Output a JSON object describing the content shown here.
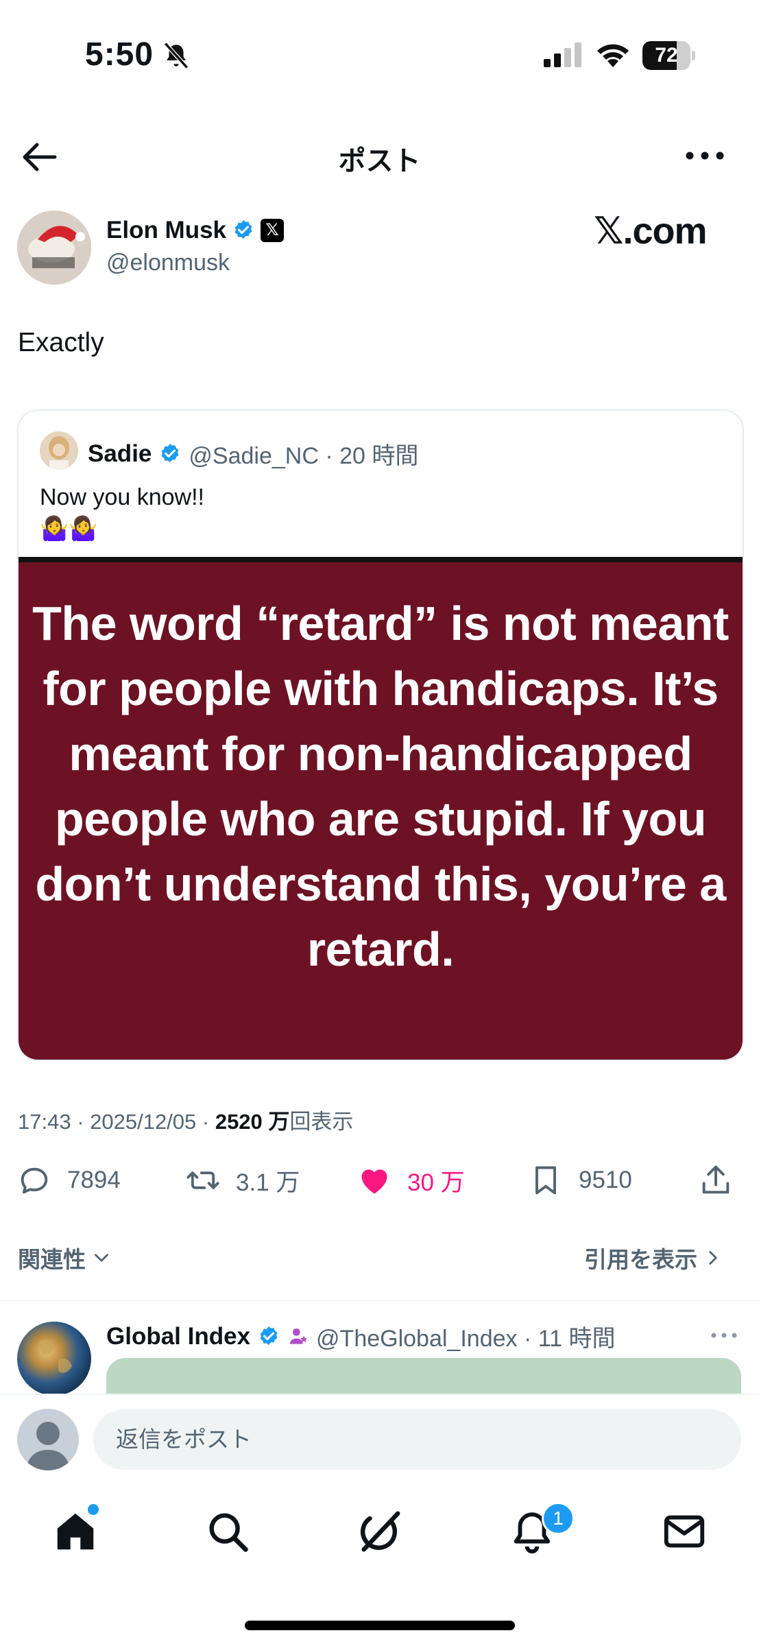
{
  "status_bar": {
    "time": "5:50",
    "battery": "72",
    "battery_level": 0.72
  },
  "header": {
    "title": "ポスト",
    "back_icon": "arrow-left-icon",
    "more_icon": "more-horizontal-icon"
  },
  "author": {
    "name": "Elon Musk",
    "handle": "@elonmusk",
    "verified": true,
    "affiliate_badge": "𝕏"
  },
  "brand": {
    "watermark": "𝕏.com"
  },
  "post": {
    "text": "Exactly"
  },
  "quote": {
    "name": "Sadie",
    "handle_time": "@Sadie_NC · 20 時間",
    "text": "Now you know!!",
    "emoji": "🤷‍♀️🤷‍♀️",
    "image_text": "The word “retard” is not meant for people with handicaps. It’s meant for non-handicapped people who are stupid. If you don’t understand this, you’re a retard.",
    "image_bg": "#6d1224"
  },
  "meta": {
    "time_date": "17:43 · 2025/12/05 · ",
    "views_value": "2520 万",
    "views_label": "回表示"
  },
  "actions": {
    "replies": "7894",
    "reposts": "3.1 万",
    "likes": "30 万",
    "bookmarks": "9510"
  },
  "filters": {
    "relevance": "関連性",
    "quotes": "引用を表示"
  },
  "reply": {
    "name": "Global Index",
    "handle_time": "@TheGlobal_Index · 11 時間"
  },
  "compose": {
    "placeholder": "返信をポスト"
  },
  "tabbar": {
    "notification_count": "1"
  },
  "colors": {
    "like": "#f91880",
    "verified": "#1d9bf0",
    "secondary_text": "#536471"
  }
}
